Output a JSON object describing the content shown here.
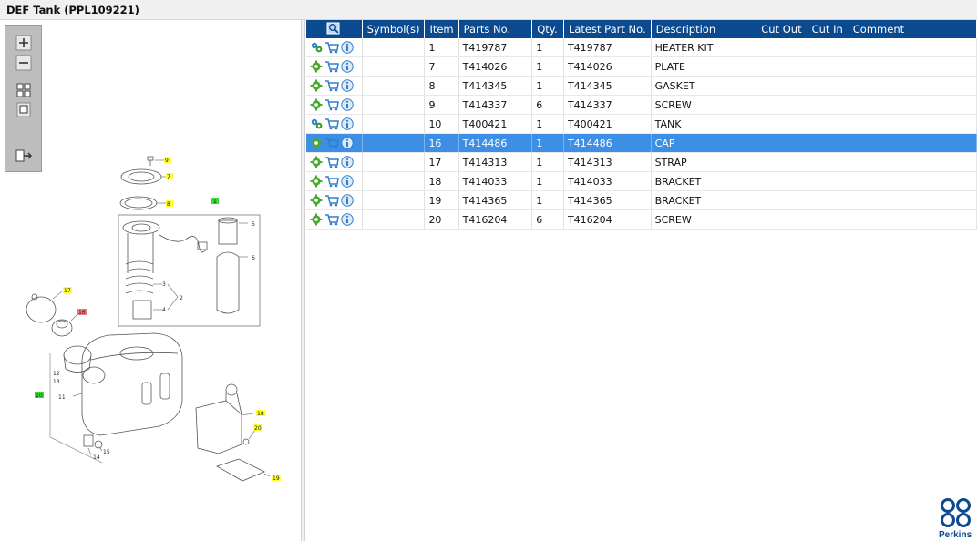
{
  "window": {
    "title": "DEF Tank (PPL109221)"
  },
  "toolbar": {
    "zoom_in": "zoom-in",
    "zoom_out": "zoom-out",
    "fit": "fit-page",
    "actual": "actual-size",
    "export": "export"
  },
  "grid": {
    "columns": [
      "Symbol(s)",
      "Item",
      "Parts No.",
      "Qty.",
      "Latest Part No.",
      "Description",
      "Cut Out",
      "Cut In",
      "Comment"
    ],
    "rows": [
      {
        "item": "1",
        "part": "T419787",
        "qty": "1",
        "latest": "T419787",
        "desc": "HEATER KIT",
        "icon": "multi-gear"
      },
      {
        "item": "7",
        "part": "T414026",
        "qty": "1",
        "latest": "T414026",
        "desc": "PLATE",
        "icon": "gear"
      },
      {
        "item": "8",
        "part": "T414345",
        "qty": "1",
        "latest": "T414345",
        "desc": "GASKET",
        "icon": "gear"
      },
      {
        "item": "9",
        "part": "T414337",
        "qty": "6",
        "latest": "T414337",
        "desc": "SCREW",
        "icon": "gear"
      },
      {
        "item": "10",
        "part": "T400421",
        "qty": "1",
        "latest": "T400421",
        "desc": "TANK",
        "icon": "multi-gear"
      },
      {
        "item": "16",
        "part": "T414486",
        "qty": "1",
        "latest": "T414486",
        "desc": "CAP",
        "icon": "gear",
        "selected": true
      },
      {
        "item": "17",
        "part": "T414313",
        "qty": "1",
        "latest": "T414313",
        "desc": "STRAP",
        "icon": "gear"
      },
      {
        "item": "18",
        "part": "T414033",
        "qty": "1",
        "latest": "T414033",
        "desc": "BRACKET",
        "icon": "gear"
      },
      {
        "item": "19",
        "part": "T414365",
        "qty": "1",
        "latest": "T414365",
        "desc": "BRACKET",
        "icon": "gear"
      },
      {
        "item": "20",
        "part": "T416204",
        "qty": "6",
        "latest": "T416204",
        "desc": "SCREW",
        "icon": "gear"
      }
    ]
  },
  "diagram_labels": {
    "l9": "9",
    "l7": "7",
    "l8": "8",
    "l1": "1",
    "l5": "5",
    "l6": "6",
    "l3": "3",
    "l2": "2",
    "l4": "4",
    "l17": "17",
    "l16": "16",
    "l10": "10",
    "l11": "11",
    "l12": "12",
    "l13": "13",
    "l14": "14",
    "l15": "15",
    "l18": "18",
    "l20": "20",
    "l19": "19"
  },
  "logo": {
    "text": "Perkins"
  },
  "colors": {
    "header": "#0b4a8f",
    "selected": "#3d8fe6",
    "callout_yellow": "#ffff33",
    "callout_green": "#33dd33",
    "callout_red": "#ee7777"
  }
}
